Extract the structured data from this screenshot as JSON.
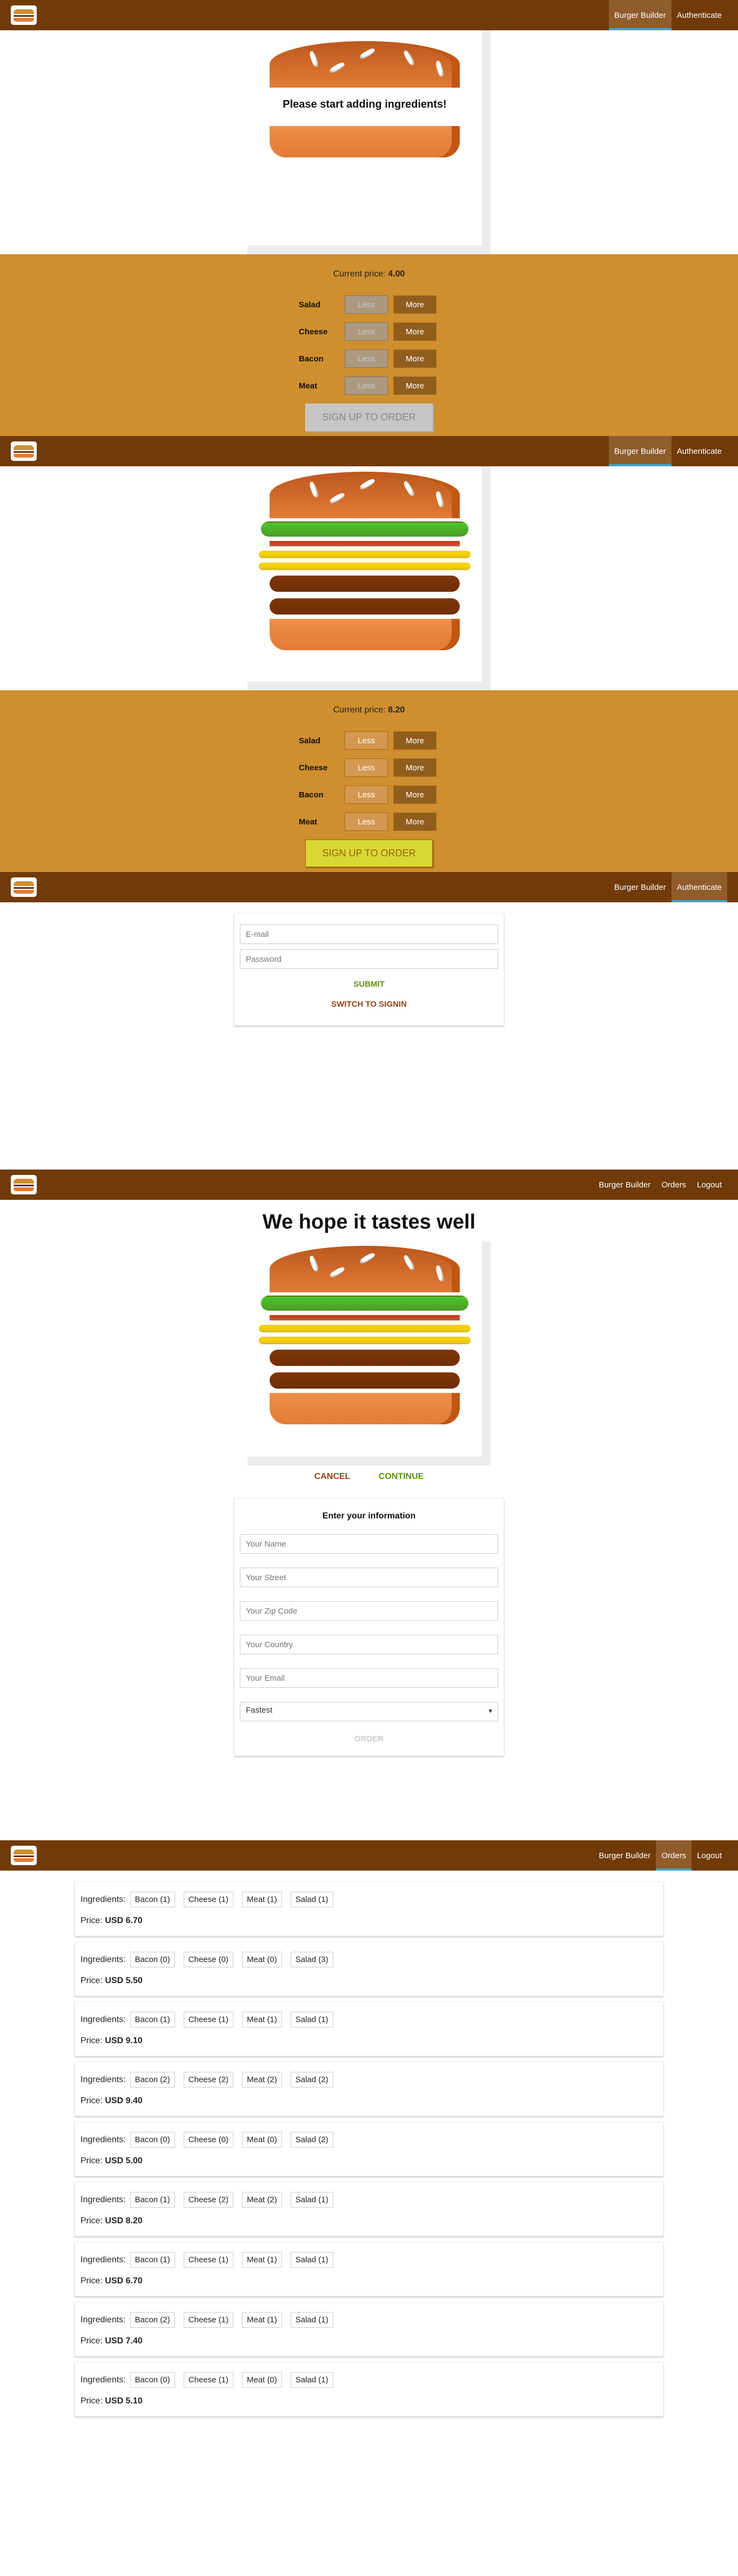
{
  "nav": {
    "burger_builder": "Burger Builder",
    "authenticate": "Authenticate",
    "orders": "Orders",
    "logout": "Logout"
  },
  "builder_empty": {
    "message": "Please start adding ingredients!",
    "price_label": "Current price:",
    "price": "4.00",
    "order_button": "SIGN UP TO ORDER"
  },
  "builder_full": {
    "price_label": "Current price:",
    "price": "8.20",
    "order_button": "SIGN UP TO ORDER"
  },
  "controls": [
    {
      "label": "Salad",
      "less": "Less",
      "more": "More"
    },
    {
      "label": "Cheese",
      "less": "Less",
      "more": "More"
    },
    {
      "label": "Bacon",
      "less": "Less",
      "more": "More"
    },
    {
      "label": "Meat",
      "less": "Less",
      "more": "More"
    }
  ],
  "auth": {
    "email_placeholder": "E-mail",
    "password_placeholder": "Password",
    "submit": "SUBMIT",
    "switch": "SWITCH TO SIGNIN"
  },
  "checkout": {
    "title": "We hope it tastes well",
    "cancel": "CANCEL",
    "continue": "CONTINUE",
    "contact_title": "Enter your information",
    "name_placeholder": "Your Name",
    "street_placeholder": "Your Street",
    "zip_placeholder": "Your Zip Code",
    "country_placeholder": "Your Country",
    "email_placeholder": "Your Email",
    "delivery_selected": "Fastest",
    "order_button": "ORDER"
  },
  "orders": {
    "ingredients_label": "Ingredients:",
    "price_label": "Price:",
    "currency": "USD",
    "list": [
      {
        "bacon": "Bacon (1)",
        "cheese": "Cheese (1)",
        "meat": "Meat (1)",
        "salad": "Salad (1)",
        "price": "6.70"
      },
      {
        "bacon": "Bacon (0)",
        "cheese": "Cheese (0)",
        "meat": "Meat (0)",
        "salad": "Salad (3)",
        "price": "5.50"
      },
      {
        "bacon": "Bacon (1)",
        "cheese": "Cheese (1)",
        "meat": "Meat (1)",
        "salad": "Salad (1)",
        "price": "9.10"
      },
      {
        "bacon": "Bacon (2)",
        "cheese": "Cheese (2)",
        "meat": "Meat (2)",
        "salad": "Salad (2)",
        "price": "9.40"
      },
      {
        "bacon": "Bacon (0)",
        "cheese": "Cheese (0)",
        "meat": "Meat (0)",
        "salad": "Salad (2)",
        "price": "5.00"
      },
      {
        "bacon": "Bacon (1)",
        "cheese": "Cheese (2)",
        "meat": "Meat (2)",
        "salad": "Salad (1)",
        "price": "8.20"
      },
      {
        "bacon": "Bacon (1)",
        "cheese": "Cheese (1)",
        "meat": "Meat (1)",
        "salad": "Salad (1)",
        "price": "6.70"
      },
      {
        "bacon": "Bacon (2)",
        "cheese": "Cheese (1)",
        "meat": "Meat (1)",
        "salad": "Salad (1)",
        "price": "7.40"
      },
      {
        "bacon": "Bacon (0)",
        "cheese": "Cheese (1)",
        "meat": "Meat (0)",
        "salad": "Salad (1)",
        "price": "5.10"
      }
    ]
  },
  "icons": {
    "logo": "burger-logo-icon",
    "dropdown": "chevron-down-icon"
  },
  "colors": {
    "toolbar": "#703b09",
    "controls_bg": "#cf8f2e",
    "active_nav": "#8f5c2c",
    "active_underline": "#40a4c8"
  }
}
